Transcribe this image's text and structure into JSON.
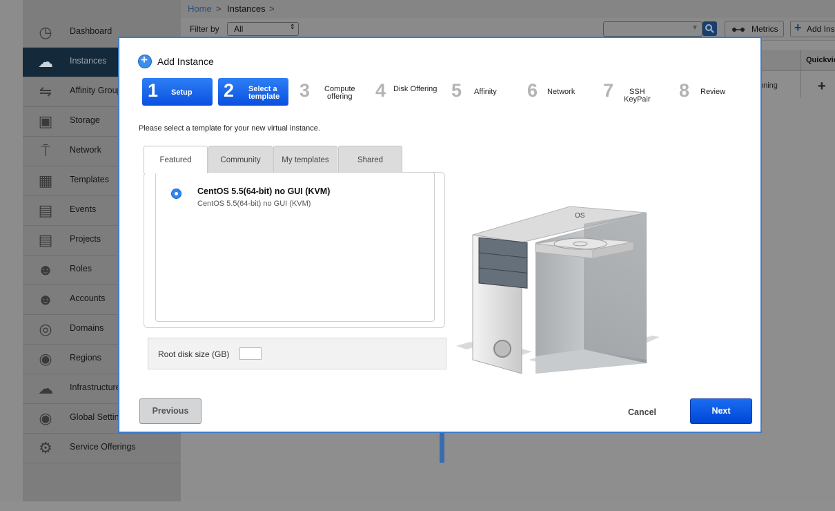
{
  "breadcrumb": {
    "home": "Home",
    "separator": ">",
    "current": "Instances"
  },
  "filter": {
    "label": "Filter by",
    "value": "All"
  },
  "toolbar": {
    "metrics_label": "Metrics",
    "add_instance_label": "Add Ins"
  },
  "table": {
    "quickview_header": "Quickvie",
    "status_fragment": "nning"
  },
  "sidebar": {
    "items": [
      {
        "label": "Dashboard",
        "icon": "dashboard-icon"
      },
      {
        "label": "Instances",
        "icon": "cloud-icon",
        "active": true
      },
      {
        "label": "Affinity Group",
        "icon": "affinity-icon"
      },
      {
        "label": "Storage",
        "icon": "storage-icon"
      },
      {
        "label": "Network",
        "icon": "network-icon"
      },
      {
        "label": "Templates",
        "icon": "templates-icon"
      },
      {
        "label": "Events",
        "icon": "calendar-icon"
      },
      {
        "label": "Projects",
        "icon": "folder-icon"
      },
      {
        "label": "Roles",
        "icon": "roles-icon"
      },
      {
        "label": "Accounts",
        "icon": "user-icon"
      },
      {
        "label": "Domains",
        "icon": "domains-icon"
      },
      {
        "label": "Regions",
        "icon": "globe-icon"
      },
      {
        "label": "Infrastructure",
        "icon": "infrastructure-icon"
      },
      {
        "label": "Global Settings",
        "icon": "global-settings-icon"
      },
      {
        "label": "Service Offerings",
        "icon": "gear-icon"
      }
    ]
  },
  "dialog": {
    "title": "Add Instance",
    "steps": [
      {
        "num": "1",
        "label": "Setup"
      },
      {
        "num": "2",
        "label1": "Select a",
        "label2": "template"
      },
      {
        "num": "3",
        "label1": "Compute",
        "label2": "offering"
      },
      {
        "num": "4",
        "label": "Disk Offering"
      },
      {
        "num": "5",
        "label": "Affinity"
      },
      {
        "num": "6",
        "label": "Network"
      },
      {
        "num": "7",
        "label1": "SSH",
        "label2": "KeyPair"
      },
      {
        "num": "8",
        "label": "Review"
      }
    ],
    "instruction": "Please select a template for your new virtual instance.",
    "tabs": [
      "Featured",
      "Community",
      "My templates",
      "Shared"
    ],
    "template": {
      "name": "CentOS 5.5(64-bit) no GUI (KVM)",
      "description": "CentOS 5.5(64-bit) no GUI (KVM)",
      "selected": true
    },
    "root_disk_label": "Root disk size (GB)",
    "root_disk_value": "",
    "os_label": "OS",
    "buttons": {
      "previous": "Previous",
      "cancel": "Cancel",
      "next": "Next"
    }
  },
  "colors": {
    "accent": "#0a50e0",
    "sidebar_active": "#14293a",
    "frame": "#3e7cc8"
  }
}
